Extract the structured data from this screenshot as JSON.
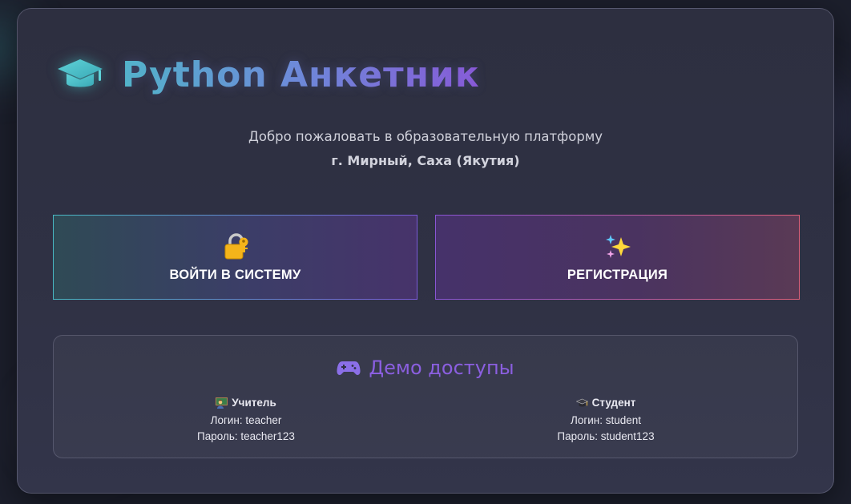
{
  "app": {
    "title": "Python Анкетник"
  },
  "welcome": {
    "line1": "Добро пожаловать в образовательную платформу",
    "line2": "г. Мирный, Саха (Якутия)"
  },
  "buttons": {
    "login_label": "ВОЙТИ В СИСТЕМУ",
    "login_icon": "lock-icon",
    "register_label": "РЕГИСТРАЦИЯ",
    "register_icon": "sparkles-icon"
  },
  "demo": {
    "title": "Демо доступы",
    "title_icon": "gamepad-icon",
    "teacher": {
      "icon": "teacher-icon",
      "role": "Учитель",
      "login": "Логин: teacher",
      "password": "Пароль: teacher123"
    },
    "student": {
      "icon": "graduation-cap-icon",
      "role": "Студент",
      "login": "Логин: student",
      "password": "Пароль: student123"
    }
  },
  "colors": {
    "accent_cyan": "#4fb9c7",
    "accent_purple": "#8a56d6",
    "accent_pink": "#e0607a",
    "background": "#1c1f2c"
  }
}
